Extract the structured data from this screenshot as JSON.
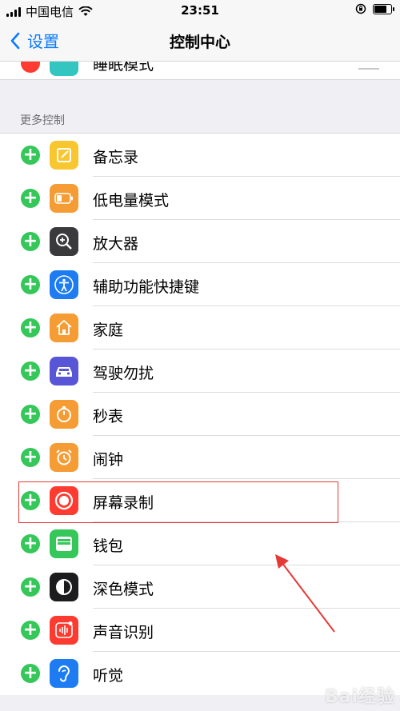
{
  "status_bar": {
    "carrier": "中国电信",
    "time": "23:51",
    "battery_level": 0.85
  },
  "nav": {
    "back_label": "设置",
    "title": "控制中心"
  },
  "peek_row": {
    "label": "睡眠模式"
  },
  "section": {
    "header": "更多控制"
  },
  "items": [
    {
      "label": "备忘录",
      "icon": "notes-icon",
      "color": "#f8c62f"
    },
    {
      "label": "低电量模式",
      "icon": "battery-icon",
      "color": "#f59c34"
    },
    {
      "label": "放大器",
      "icon": "magnifier-icon",
      "color": "#3a3a3c"
    },
    {
      "label": "辅助功能快捷键",
      "icon": "accessibility-icon",
      "color": "#1d7cf2"
    },
    {
      "label": "家庭",
      "icon": "home-icon",
      "color": "#f59c34"
    },
    {
      "label": "驾驶勿扰",
      "icon": "car-icon",
      "color": "#5856d6"
    },
    {
      "label": "秒表",
      "icon": "stopwatch-icon",
      "color": "#f59c34"
    },
    {
      "label": "闹钟",
      "icon": "alarm-icon",
      "color": "#f59c34"
    },
    {
      "label": "屏幕录制",
      "icon": "screen-record-icon",
      "color": "#fe3b30"
    },
    {
      "label": "钱包",
      "icon": "wallet-icon",
      "color": "#35c759"
    },
    {
      "label": "深色模式",
      "icon": "dark-mode-icon",
      "color": "#1c1c1e"
    },
    {
      "label": "声音识别",
      "icon": "sound-recognition-icon",
      "color": "#fe3b30"
    },
    {
      "label": "听觉",
      "icon": "ear-icon",
      "color": "#1d7cf2"
    }
  ],
  "watermark": "Bai经验"
}
